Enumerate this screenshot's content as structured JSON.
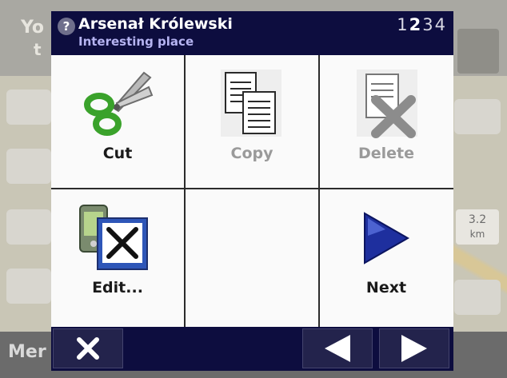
{
  "background": {
    "top_text_1": "Yo",
    "top_text_2": "t",
    "distance_value": "3.2",
    "distance_unit": "km",
    "menu_label": "Mer"
  },
  "dialog": {
    "title": "Arsenał Królewski",
    "subtitle": "Interesting place",
    "pager": [
      "1",
      "2",
      "3",
      "4"
    ],
    "pager_active_index": 1,
    "grid": [
      {
        "label": "Cut",
        "icon": "scissors-icon",
        "enabled": true
      },
      {
        "label": "Copy",
        "icon": "copy-icon",
        "enabled": false
      },
      {
        "label": "Delete",
        "icon": "delete-icon",
        "enabled": false
      },
      {
        "label": "Edit...",
        "icon": "edit-poi-icon",
        "enabled": true
      },
      {
        "label": "",
        "icon": "",
        "enabled": false
      },
      {
        "label": "Next",
        "icon": "next-arrow-icon",
        "enabled": true
      }
    ]
  },
  "bottombar": {
    "close_icon": "close-icon",
    "prev_icon": "left-arrow-icon",
    "next_icon": "right-arrow-icon"
  },
  "colors": {
    "header_bg": "#0d0d3f",
    "subtitle": "#b6b4f2",
    "disabled_text": "#9a9a9a"
  }
}
